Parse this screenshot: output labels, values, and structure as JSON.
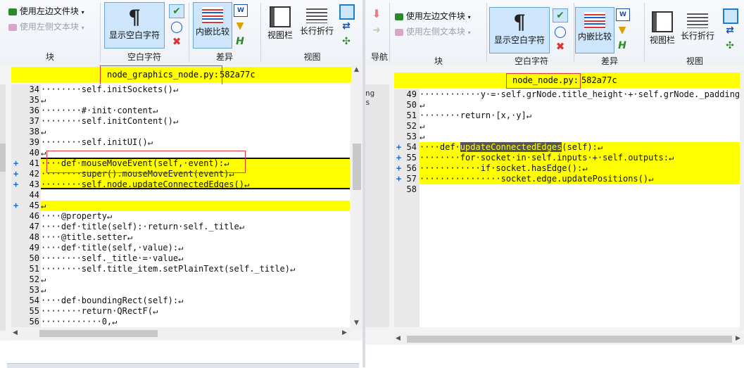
{
  "left_ribbon": {
    "block_group": {
      "use_left_text_label": "使用左边文件块",
      "use_left_side_text_label": "使用左侧文本块",
      "group_label": "块"
    },
    "whitespace_group": {
      "show_whitespace_label": "显示空白字符",
      "group_label": "空白字符"
    },
    "diff_group": {
      "inline_compare_label": "内嵌比较",
      "group_label": "差异"
    },
    "view_group": {
      "view_bar_label": "视图栏",
      "wrap_long_lines_label": "长行折行",
      "group_label": "视图"
    }
  },
  "right_ribbon": {
    "nav_group": {
      "group_label": "导航"
    },
    "block_group": {
      "use_left_text_label": "使用左边文件块",
      "use_left_side_text_label": "使用左侧文本块",
      "group_label": "块"
    },
    "whitespace_group": {
      "show_whitespace_label": "显示空白字符",
      "group_label": "空白字符"
    },
    "diff_group": {
      "inline_compare_label": "内嵌比较",
      "group_label": "差异"
    },
    "view_group": {
      "view_bar_label": "视图栏",
      "wrap_long_lines_label": "长行折行",
      "group_label": "视图"
    }
  },
  "left_pane": {
    "filename": "node_graphics_node.py:",
    "revision": "582a77c",
    "lines": [
      {
        "num": "34",
        "text": "········self.initSockets()↵",
        "hl": false,
        "plus": false
      },
      {
        "num": "35",
        "text": "↵",
        "hl": false,
        "plus": false
      },
      {
        "num": "36",
        "text": "········#·init·content↵",
        "hl": false,
        "plus": false
      },
      {
        "num": "37",
        "text": "········self.initContent()↵",
        "hl": false,
        "plus": false
      },
      {
        "num": "38",
        "text": "↵",
        "hl": false,
        "plus": false
      },
      {
        "num": "39",
        "text": "········self.initUI()↵",
        "hl": false,
        "plus": false
      },
      {
        "num": "40",
        "text": "↵",
        "hl": false,
        "plus": false
      },
      {
        "num": "41",
        "text": "····def·mouseMoveEvent(self,·event):↵",
        "hl": true,
        "plus": true
      },
      {
        "num": "42",
        "text": "········super().mouseMoveEvent(event)↵",
        "hl": true,
        "plus": true
      },
      {
        "num": "43",
        "text": "········self.node.updateConnectedEdges()↵",
        "hl": true,
        "plus": true
      },
      {
        "num": "44",
        "text": "",
        "hl": false,
        "plus": false
      },
      {
        "num": "45",
        "text": "↵",
        "hl": true,
        "plus": true
      },
      {
        "num": "46",
        "text": "····@property↵",
        "hl": false,
        "plus": false
      },
      {
        "num": "47",
        "text": "····def·title(self):·return·self._title↵",
        "hl": false,
        "plus": false
      },
      {
        "num": "48",
        "text": "····@title.setter↵",
        "hl": false,
        "plus": false
      },
      {
        "num": "49",
        "text": "····def·title(self,·value):↵",
        "hl": false,
        "plus": false
      },
      {
        "num": "50",
        "text": "········self._title·=·value↵",
        "hl": false,
        "plus": false
      },
      {
        "num": "51",
        "text": "········self.title_item.setPlainText(self._title)↵",
        "hl": false,
        "plus": false
      },
      {
        "num": "52",
        "text": "↵",
        "hl": false,
        "plus": false
      },
      {
        "num": "53",
        "text": "↵",
        "hl": false,
        "plus": false
      },
      {
        "num": "54",
        "text": "····def·boundingRect(self):↵",
        "hl": false,
        "plus": false
      },
      {
        "num": "55",
        "text": "········return·QRectF(↵",
        "hl": false,
        "plus": false
      },
      {
        "num": "56",
        "text": "············0,↵",
        "hl": false,
        "plus": false
      }
    ]
  },
  "right_pane": {
    "filename": "node_node.py:",
    "revision": "582a77c",
    "lines": [
      {
        "num": "49",
        "text": "············y·=·self.grNode.title_height·+·self.grNode._padding·",
        "hl": false,
        "plus": false
      },
      {
        "num": "50",
        "text": "↵",
        "hl": false,
        "plus": false
      },
      {
        "num": "51",
        "text": "········return·[x,·y]↵",
        "hl": false,
        "plus": false
      },
      {
        "num": "52",
        "text": "↵",
        "hl": false,
        "plus": false
      },
      {
        "num": "53",
        "text": "↵",
        "hl": false,
        "plus": false
      },
      {
        "num": "54",
        "text_before": "····def·",
        "selected": "updateConnectedEdges",
        "text_after": "(self):↵",
        "hl": true,
        "plus": true
      },
      {
        "num": "55",
        "text": "········for·socket·in·self.inputs·+·self.outputs:↵",
        "hl": true,
        "plus": true
      },
      {
        "num": "56",
        "text": "············if·socket.hasEdge():↵",
        "hl": true,
        "plus": true
      },
      {
        "num": "57",
        "text": "················socket.edge.updatePositions()↵",
        "hl": true,
        "plus": true
      },
      {
        "num": "58",
        "text": "",
        "hl": false,
        "plus": false
      }
    ]
  },
  "colors": {
    "diff_highlight": "#ffff00",
    "annotation_box": "#ee3333",
    "plus_marker": "#1a6fd0"
  }
}
